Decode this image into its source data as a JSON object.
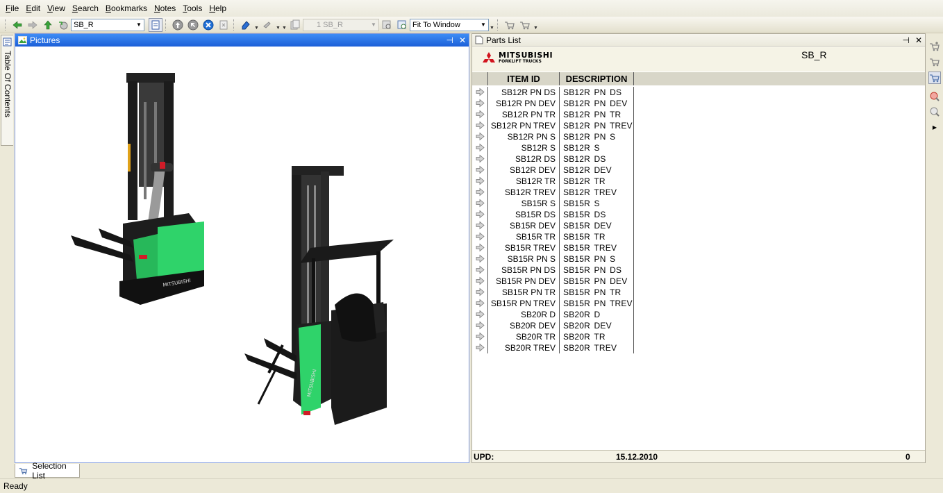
{
  "menu": {
    "items": [
      {
        "label": "File",
        "key": "F",
        "rest": "ile"
      },
      {
        "label": "Edit",
        "key": "E",
        "rest": "dit"
      },
      {
        "label": "View",
        "key": "V",
        "rest": "iew"
      },
      {
        "label": "Search",
        "key": "S",
        "rest": "earch"
      },
      {
        "label": "Bookmarks",
        "key": "B",
        "rest": "ookmarks"
      },
      {
        "label": "Notes",
        "key": "N",
        "rest": "otes"
      },
      {
        "label": "Tools",
        "key": "T",
        "rest": "ools"
      },
      {
        "label": "Help",
        "key": "H",
        "rest": "elp"
      }
    ]
  },
  "toolbar": {
    "book_combo": "SB_R",
    "page_combo": "1 SB_R",
    "zoom_combo": "Fit To Window"
  },
  "left_tab": {
    "label": "Table Of Contents"
  },
  "pictures": {
    "title": "Pictures",
    "pin": "⊣",
    "close": "✕"
  },
  "parts": {
    "title": "Parts List",
    "pin": "⊣",
    "close": "✕",
    "code": "SB_R",
    "logo_line1": "MITSUBISHI",
    "logo_line2": "FORKLIFT TRUCKS",
    "col_item": "ITEM ID",
    "col_desc": "DESCRIPTION",
    "rows": [
      {
        "id": "SB12R PN DS",
        "desc": "SB12R PN DS"
      },
      {
        "id": "SB12R PN DEV",
        "desc": "SB12R PN DEV"
      },
      {
        "id": "SB12R PN TR",
        "desc": "SB12R PN TR"
      },
      {
        "id": "SB12R PN TREV",
        "desc": "SB12R PN TREV"
      },
      {
        "id": "SB12R PN S",
        "desc": "SB12R PN S"
      },
      {
        "id": "SB12R S",
        "desc": "SB12R S"
      },
      {
        "id": "SB12R DS",
        "desc": "SB12R DS"
      },
      {
        "id": "SB12R DEV",
        "desc": "SB12R DEV"
      },
      {
        "id": "SB12R TR",
        "desc": "SB12R TR"
      },
      {
        "id": "SB12R TREV",
        "desc": "SB12R TREV"
      },
      {
        "id": "SB15R S",
        "desc": "SB15R S"
      },
      {
        "id": "SB15R DS",
        "desc": "SB15R DS"
      },
      {
        "id": "SB15R DEV",
        "desc": "SB15R DEV"
      },
      {
        "id": "SB15R TR",
        "desc": "SB15R TR"
      },
      {
        "id": "SB15R TREV",
        "desc": "SB15R TREV"
      },
      {
        "id": "SB15R PN S",
        "desc": "SB15R PN S"
      },
      {
        "id": "SB15R PN DS",
        "desc": "SB15R PN DS"
      },
      {
        "id": "SB15R PN DEV",
        "desc": "SB15R PN DEV"
      },
      {
        "id": "SB15R PN TR",
        "desc": "SB15R PN TR"
      },
      {
        "id": "SB15R PN TREV",
        "desc": "SB15R PN TREV"
      },
      {
        "id": "SB20R D",
        "desc": "SB20R D"
      },
      {
        "id": "SB20R DEV",
        "desc": "SB20R DEV"
      },
      {
        "id": "SB20R TR",
        "desc": "SB20R TR"
      },
      {
        "id": "SB20R TREV",
        "desc": "SB20R TREV"
      }
    ],
    "footer_label": "UPD:",
    "footer_date": "15.12.2010",
    "footer_count": "0"
  },
  "bottom_tab": {
    "label": "Selection List"
  },
  "status": {
    "text": "Ready"
  },
  "colors": {
    "accent_header": "#2566e0",
    "forklift_green": "#2fd36a",
    "logo_red": "#d2141e"
  }
}
